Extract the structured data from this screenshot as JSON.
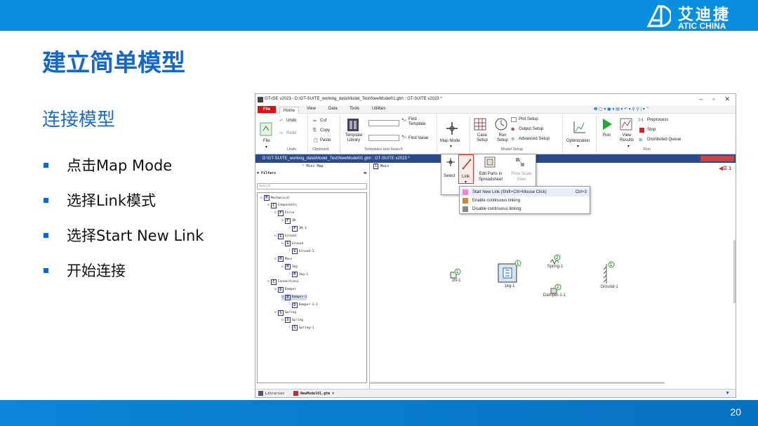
{
  "brand": {
    "name_cn": "艾迪捷",
    "name_en": "ATIC CHINA"
  },
  "slide": {
    "title": "建立简单模型",
    "subtitle": "连接模型",
    "bullets": [
      "点击Map Mode",
      "选择Link模式",
      "选择Start New Link",
      "开始连接"
    ],
    "page_number": "20"
  },
  "app": {
    "window_title": "GT-ISE v2023 - D:\\GT-SUITE_working_data\\Model_Test\\NewModel01.gtm : GT-SUITE v2023 *",
    "menu_tabs": {
      "file": "File",
      "home": "Home",
      "view": "View",
      "data": "Data",
      "tools": "Tools",
      "utilities": "Utilities"
    },
    "ribbon": {
      "file": "File",
      "undo": "Undo",
      "redo": "Redo",
      "undo_group": "Undo",
      "cut": "Cut",
      "copy": "Copy",
      "paste": "Paste",
      "clipboard_group": "Clipboard",
      "template_library": "Template Library",
      "find_template": "Find Template",
      "find_value": "Find Value",
      "templates_group": "Templates and Search",
      "map_mode": "Map Mode",
      "case_setup": "Case Setup",
      "run_setup": "Run Setup",
      "plot_setup": "Plot Setup",
      "output_setup": "Output Setup",
      "advanced_setup": "Advanced Setup",
      "model_setup_group": "Model Setup",
      "optimization": "Optimization",
      "run": "Run",
      "view_results": "View Results",
      "preprocess": "Preprocess",
      "stop": "Stop",
      "distributed_queue": "Distributed Queue",
      "run_group": "Run"
    },
    "map_dropdown": {
      "select": "Select",
      "link": "Link",
      "edit_parts": "Edit Parts in Spreadsheet",
      "flow_scale": "Flow Scale View"
    },
    "link_menu": [
      {
        "label": "Start New Link (Shift+Ctrl+Mouse Click)",
        "shortcut": "Ctrl+3"
      },
      {
        "label": "Enable continuous linking",
        "shortcut": ""
      },
      {
        "label": "Disable continuous linking",
        "shortcut": ""
      }
    ],
    "doc_title": "D:\\GT-SUITE_working_data\\Model_Test\\NewModel01.gtm : GT-SUITE v2023 *",
    "sidebar": {
      "minimap": "Mini Map",
      "filters": "Filters",
      "search_placeholder": "Search",
      "tree": [
        {
          "label": "Mechanical",
          "icon": "M",
          "level": 0
        },
        {
          "label": "Components",
          "icon": "C",
          "level": 1
        },
        {
          "label": "Force",
          "icon": "F",
          "level": 2
        },
        {
          "label": "1N",
          "icon": "F",
          "level": 3
        },
        {
          "label": "1N-1",
          "icon": "F",
          "level": 4
        },
        {
          "label": "Ground",
          "icon": "G",
          "level": 2
        },
        {
          "label": "Ground",
          "icon": "G",
          "level": 3
        },
        {
          "label": "Ground-1",
          "icon": "G",
          "level": 4
        },
        {
          "label": "Mass",
          "icon": "M",
          "level": 2
        },
        {
          "label": "1kg",
          "icon": "M",
          "level": 3
        },
        {
          "label": "1kg-1",
          "icon": "M",
          "level": 4
        },
        {
          "label": "Connections",
          "icon": "C",
          "level": 1
        },
        {
          "label": "Damper",
          "icon": "D",
          "level": 2
        },
        {
          "label": "Damper-1",
          "icon": "D",
          "level": 3
        },
        {
          "label": "Damper-1-1",
          "icon": "D",
          "level": 4
        },
        {
          "label": "Spring",
          "icon": "S",
          "level": 2
        },
        {
          "label": "Spring",
          "icon": "S",
          "level": 3
        },
        {
          "label": "Spring-1",
          "icon": "S",
          "level": 4
        }
      ]
    },
    "canvas": {
      "tab": "Main",
      "components": {
        "force": "1N-1",
        "mass": "1kg-1",
        "spring": "Spring-1",
        "damper": "Damper-1-1",
        "ground": "Ground-1"
      },
      "badges": {
        "one": "1",
        "two": "2"
      },
      "nav_count": "1"
    },
    "bottom_tabs": [
      "Libraries",
      "NewModel01.gtm ×"
    ]
  }
}
